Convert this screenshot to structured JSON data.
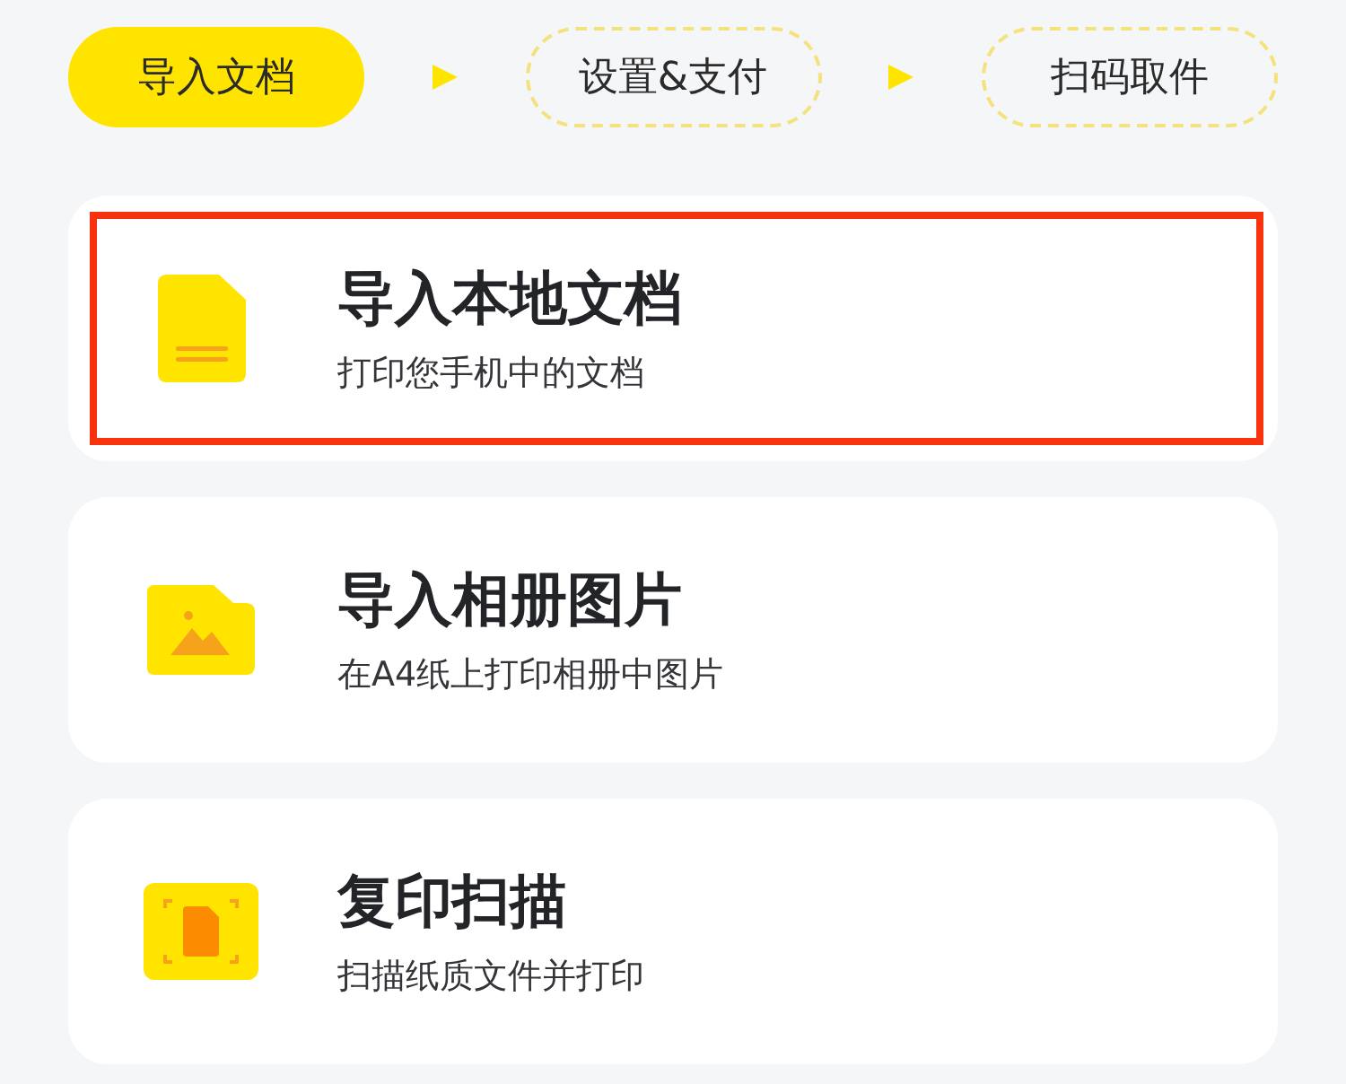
{
  "steps": [
    {
      "label": "导入文档",
      "selected": true
    },
    {
      "label": "设置&支付",
      "selected": false
    },
    {
      "label": "扫码取件",
      "selected": false
    }
  ],
  "cards": [
    {
      "kind": "document",
      "title": "导入本地文档",
      "subtitle": "打印您手机中的文档",
      "highlighted": true
    },
    {
      "kind": "image",
      "title": "导入相册图片",
      "subtitle": "在A4纸上打印相册中图片",
      "highlighted": false
    },
    {
      "kind": "scan",
      "title": "复印扫描",
      "subtitle": "扫描纸质文件并打印",
      "highlighted": false
    }
  ]
}
